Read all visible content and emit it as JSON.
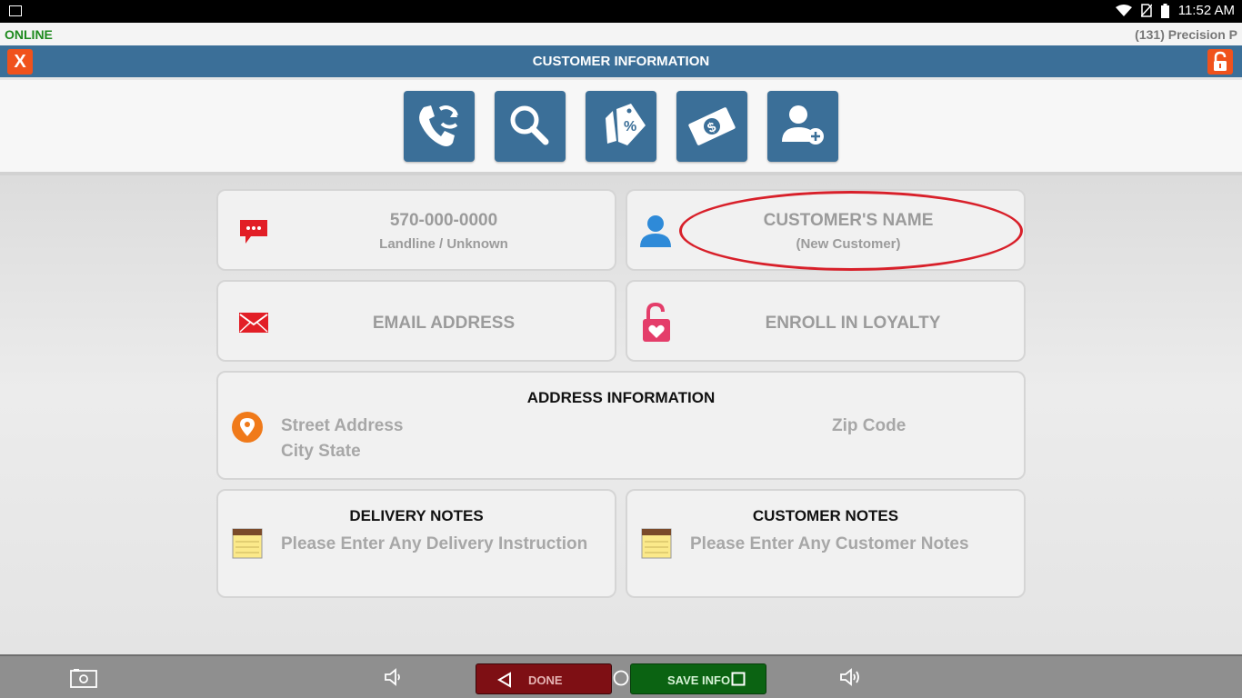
{
  "status_bar": {
    "time": "11:52 AM",
    "icons": [
      "gallery-icon",
      "wifi-icon",
      "no-sim-icon",
      "battery-icon"
    ]
  },
  "top_info": {
    "connection_status": "ONLINE",
    "store_label": "(131) Precision P"
  },
  "header": {
    "title": "CUSTOMER INFORMATION",
    "close_label": "X",
    "lock_icon": "lock-icon"
  },
  "toolbar": {
    "tools": [
      "phone-lookup-icon",
      "search-icon",
      "coupon-tags-icon",
      "money-icon",
      "add-customer-icon"
    ]
  },
  "phone_card": {
    "number": "570-000-0000",
    "type": "Landline / Unknown"
  },
  "name_card": {
    "name_placeholder": "CUSTOMER'S NAME",
    "status": "(New Customer)"
  },
  "email_card": {
    "label": "EMAIL ADDRESS"
  },
  "loyalty_card": {
    "label": "ENROLL IN LOYALTY"
  },
  "address_card": {
    "heading": "ADDRESS INFORMATION",
    "street_placeholder": "Street Address",
    "city_state_placeholder": "City State",
    "zip_placeholder": "Zip Code"
  },
  "delivery_notes": {
    "heading": "DELIVERY NOTES",
    "placeholder": "Please Enter Any Delivery Instruction"
  },
  "customer_notes": {
    "heading": "CUSTOMER NOTES",
    "placeholder": "Please Enter Any Customer Notes"
  },
  "bottom_bar": {
    "done_label": "DONE",
    "save_label": "SAVE INFO"
  },
  "colors": {
    "header_blue": "#3b6f98",
    "accent_orange": "#f0521c",
    "online_green": "#1e8a1e",
    "annotation_red": "#d8202a",
    "done_red": "#7e0f14",
    "save_green": "#0b6312"
  }
}
